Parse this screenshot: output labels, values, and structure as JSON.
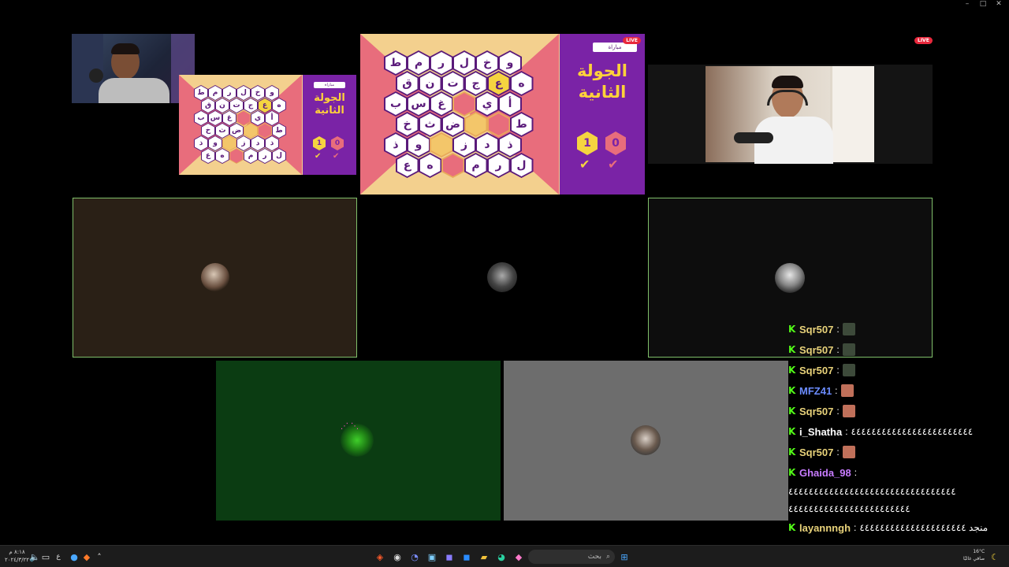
{
  "window": {
    "controls": [
      "–",
      "□",
      "✕"
    ]
  },
  "game_large": {
    "button_label": "مباراة",
    "round_title_1": "الجولة",
    "round_title_2": "الثانية",
    "score_left": "1",
    "score_right": "0",
    "live": "LIVE",
    "rows": [
      [
        "ط",
        "م",
        "ر",
        "ل",
        "خ",
        "و"
      ],
      [
        "ق",
        "ن",
        "ت",
        "ج",
        "ع",
        "ه"
      ],
      [
        "ب",
        "س",
        "غ",
        "",
        "ي",
        "أ"
      ],
      [
        "خ",
        "ث",
        "ض",
        "",
        "",
        "ط"
      ],
      [
        "ذ",
        "و",
        "",
        "ز",
        "د",
        "ذ"
      ],
      [
        "ع",
        "ه",
        "",
        "م",
        "ر",
        "ل"
      ]
    ]
  },
  "game_small": {
    "button_label": "مباراة",
    "round_title_1": "الجولة",
    "round_title_2": "الثانية",
    "score_left": "1",
    "score_right": "0",
    "rows": [
      [
        "ط",
        "م",
        "ر",
        "ل",
        "خ",
        "و"
      ],
      [
        "ق",
        "ن",
        "ت",
        "ج",
        "ع",
        "ه"
      ],
      [
        "ب",
        "س",
        "غ",
        "",
        "ي",
        "أ"
      ],
      [
        "خ",
        "ث",
        "ض",
        "",
        "",
        "ط"
      ],
      [
        "ذ",
        "و",
        "",
        "ز",
        "د",
        "ذ"
      ],
      [
        "ع",
        "ه",
        "",
        "م",
        "ر",
        "ل"
      ]
    ]
  },
  "top_right_live": "LIVE",
  "chat": {
    "messages": [
      {
        "user": "Sqr507",
        "color": "#e8d27a",
        "text": "",
        "emote": "#3d4a3a"
      },
      {
        "user": "Sqr507",
        "color": "#e8d27a",
        "text": "",
        "emote": "#3d4a3a"
      },
      {
        "user": "Sqr507",
        "color": "#e8d27a",
        "text": "",
        "emote": "#3d4a3a"
      },
      {
        "user": "MFZ41",
        "color": "#6b8cff",
        "text": "",
        "emote": "#c0705a"
      },
      {
        "user": "Sqr507",
        "color": "#e8d27a",
        "text": "",
        "emote": "#c0705a"
      },
      {
        "user": "i_Shatha",
        "color": "#ffffff",
        "text": "٤٤٤٤٤٤٤٤٤٤٤٤٤٤٤٤٤٤٤٤٤٤٤٤",
        "emote": ""
      },
      {
        "user": "Sqr507",
        "color": "#e8d27a",
        "text": "",
        "emote": "#c0705a"
      },
      {
        "user": "Ghaida_98",
        "color": "#c87cff",
        "text": "",
        "emote": ""
      }
    ],
    "wrap_line_1": "٤٤٤٤٤٤٤٤٤٤٤٤٤٤٤٤٤٤٤٤٤٤٤٤٤٤٤٤٤٤٤٤٤",
    "wrap_line_2": "٤٤٤٤٤٤٤٤٤٤٤٤٤٤٤٤٤٤٤٤٤٤٤٤",
    "last": {
      "user": "layannngh",
      "color": "#e8d27a",
      "text": "منجد ٤٤٤٤٤٤٤٤٤٤٤٤٤٤٤٤٤٤٤٤٤"
    }
  },
  "taskbar": {
    "search_placeholder": "بحث",
    "weather_temp": "16°C",
    "weather_desc": "صافي غالبًا",
    "time": "٨:١٨ م",
    "date": "٢٠٢٤/٣/٢٢",
    "lang": "ع"
  }
}
